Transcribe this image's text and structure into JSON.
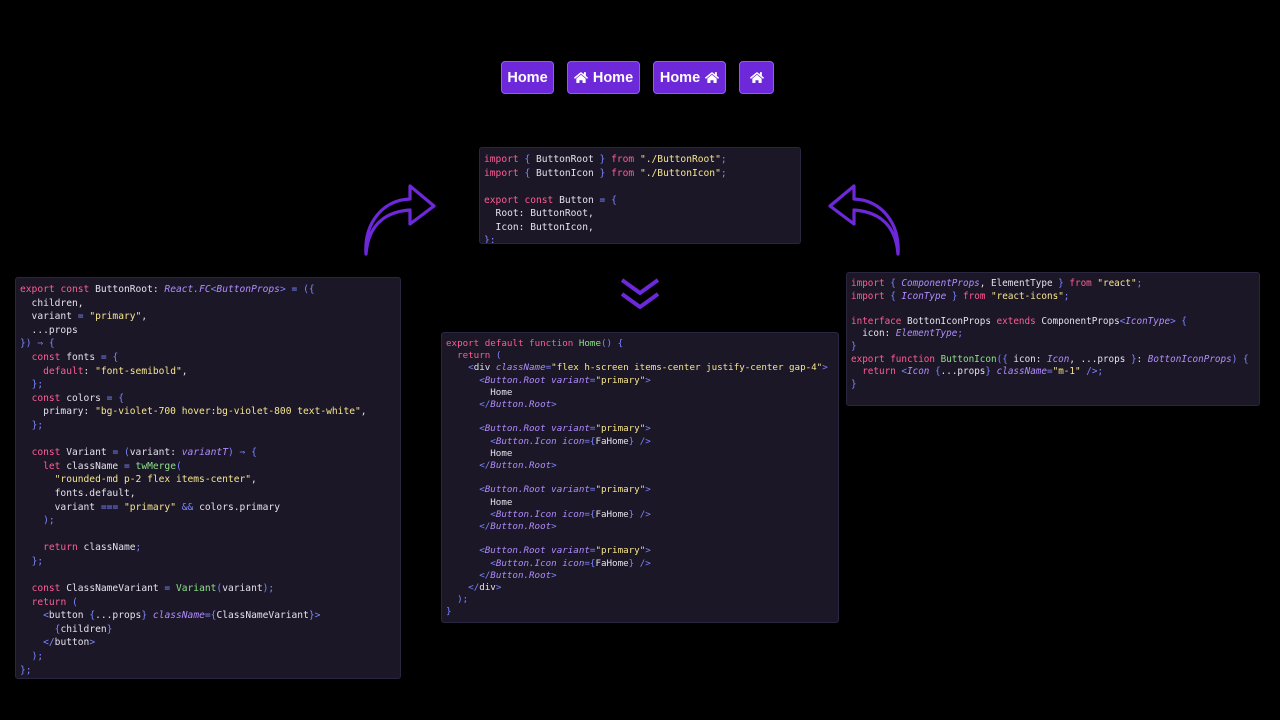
{
  "demo_buttons": {
    "btn1": {
      "label": "Home"
    },
    "btn2": {
      "label": "Home"
    },
    "btn3": {
      "label": "Home"
    },
    "btn4": {
      "label": ""
    }
  },
  "icons": {
    "home": "home-icon",
    "curved_arrow_up_right": "curved-arrow-icon",
    "curved_arrow_up_left": "curved-arrow-icon",
    "double_chevron_down": "double-chevron-down-icon"
  },
  "colors": {
    "accent": "#6d28d9",
    "panel_bg": "#1b1727",
    "keyword": "#ff5c93",
    "function": "#8de08a",
    "string": "#f6e58d",
    "type": "#b18cff",
    "param": "#ff9c4d"
  },
  "panels": {
    "top": {
      "lines": [
        "import { ButtonRoot } from \"./ButtonRoot\";",
        "import { ButtonIcon } from \"./ButtonIcon\";",
        "",
        "export const Button = {",
        "  Root: ButtonRoot,",
        "  Icon: ButtonIcon,",
        "};"
      ]
    },
    "left": {
      "lines": [
        "export const ButtonRoot: React.FC<ButtonProps> = ({",
        "  children,",
        "  variant = \"primary\",",
        "  ...props",
        "}) ⇒ {",
        "  const fonts = {",
        "    default: \"font-semibold\",",
        "  };",
        "  const colors = {",
        "    primary: \"bg-violet-700 hover:bg-violet-800 text-white\",",
        "  };",
        "",
        "  const Variant = (variant: variantT) ⇒ {",
        "    let className = twMerge(",
        "      \"rounded-md p-2 flex items-center\",",
        "      fonts.default,",
        "      variant === \"primary\" && colors.primary",
        "    );",
        "",
        "    return className;",
        "  };",
        "",
        "  const ClassNameVariant = Variant(variant);",
        "  return (",
        "    <button {...props} className={ClassNameVariant}>",
        "      {children}",
        "    </button>",
        "  );",
        "};"
      ]
    },
    "mid": {
      "lines": [
        "export default function Home() {",
        "  return (",
        "    <div className=\"flex h-screen items-center justify-center gap-4\">",
        "      <Button.Root variant=\"primary\">",
        "        Home",
        "      </Button.Root>",
        "",
        "      <Button.Root variant=\"primary\">",
        "        <Button.Icon icon={FaHome} />",
        "        Home",
        "      </Button.Root>",
        "",
        "      <Button.Root variant=\"primary\">",
        "        Home",
        "        <Button.Icon icon={FaHome} />",
        "      </Button.Root>",
        "",
        "      <Button.Root variant=\"primary\">",
        "        <Button.Icon icon={FaHome} />",
        "      </Button.Root>",
        "    </div>",
        "  );",
        "}"
      ]
    },
    "right": {
      "lines": [
        "import { ComponentProps, ElementType } from \"react\";",
        "import { IconType } from \"react-icons\";",
        "",
        "interface BottonIconProps extends ComponentProps<IconType> {",
        "  icon: ElementType;",
        "}",
        "export function ButtonIcon({ icon: Icon, ...props }: BottonIconProps) {",
        "  return <Icon {...props} className=\"m-1\" />;",
        "}"
      ]
    }
  }
}
